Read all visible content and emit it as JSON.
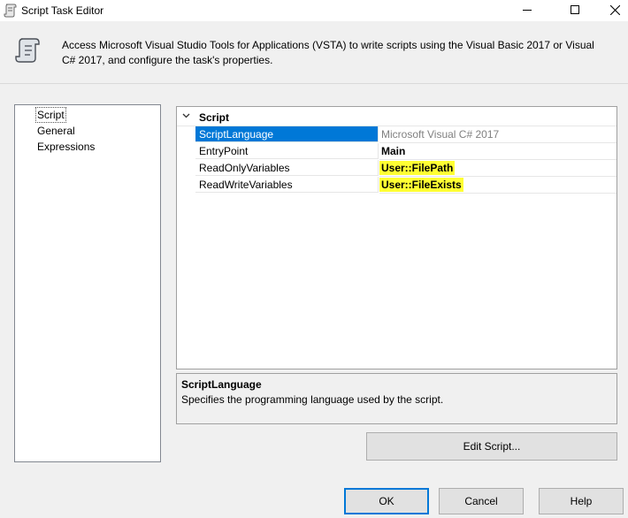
{
  "window": {
    "title": "Script Task Editor",
    "controls": {
      "minimize_icon": "minimize-icon",
      "maximize_icon": "maximize-icon",
      "close_icon": "close-icon"
    }
  },
  "header": {
    "description": "Access Microsoft Visual Studio Tools for Applications (VSTA) to write scripts using the Visual Basic 2017 or Visual C# 2017, and configure the task's properties."
  },
  "nav": {
    "items": [
      {
        "label": "Script",
        "selected": true
      },
      {
        "label": "General",
        "selected": false
      },
      {
        "label": "Expressions",
        "selected": false
      }
    ]
  },
  "grid": {
    "category": "Script",
    "properties": [
      {
        "name": "ScriptLanguage",
        "value": "Microsoft Visual C# 2017"
      },
      {
        "name": "EntryPoint",
        "value": "Main"
      },
      {
        "name": "ReadOnlyVariables",
        "value": "User::FilePath"
      },
      {
        "name": "ReadWriteVariables",
        "value": "User::FileExists"
      }
    ]
  },
  "description": {
    "title": "ScriptLanguage",
    "text": "Specifies the programming language used by the script."
  },
  "buttons": {
    "edit_script": "Edit Script...",
    "ok": "OK",
    "cancel": "Cancel",
    "help": "Help"
  },
  "colors": {
    "selection": "#0078d7",
    "highlight": "#ffff33"
  }
}
